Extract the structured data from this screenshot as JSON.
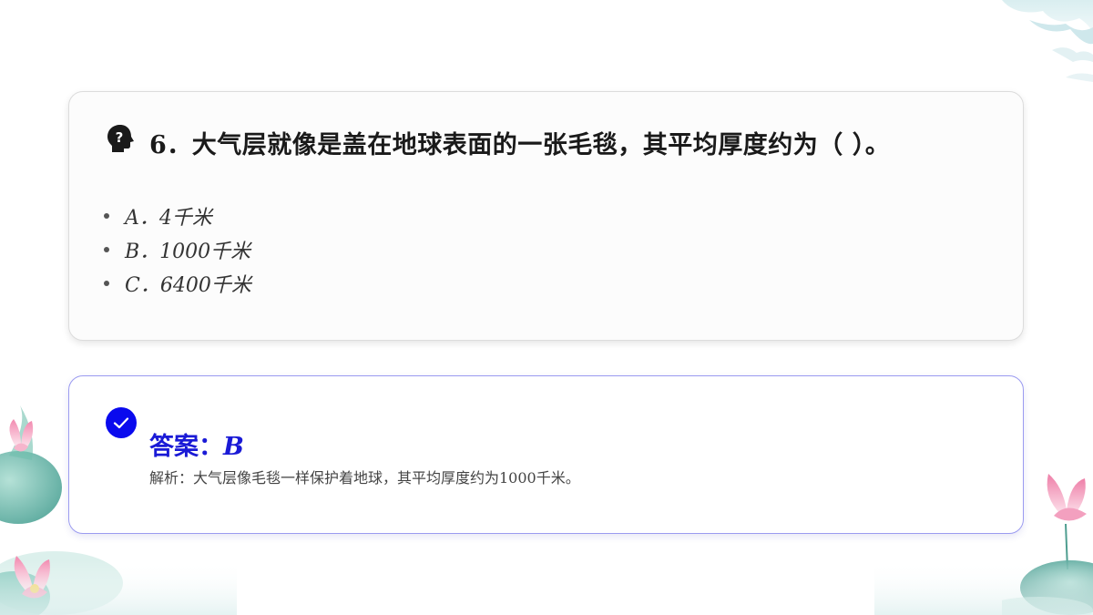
{
  "question": {
    "number_label": "6．",
    "text": "大气层就像是盖在地球表面的一张毛毯，其平均厚度约为（ ）。",
    "icon": "head-question-icon"
  },
  "options": [
    {
      "label": "A．4千米"
    },
    {
      "label": "B．1000千米"
    },
    {
      "label": "C．6400千米"
    }
  ],
  "answer": {
    "title_prefix": "答案：",
    "letter": "B",
    "icon": "check-circle-icon",
    "explanation": "解析：大气层像毛毯一样保护着地球，其平均厚度约为1000千米。"
  },
  "colors": {
    "accent": "#1a1ad6",
    "check_circle": "#0a0aee",
    "answer_border": "#9b9bf0",
    "question_border": "#dcdcdc"
  }
}
